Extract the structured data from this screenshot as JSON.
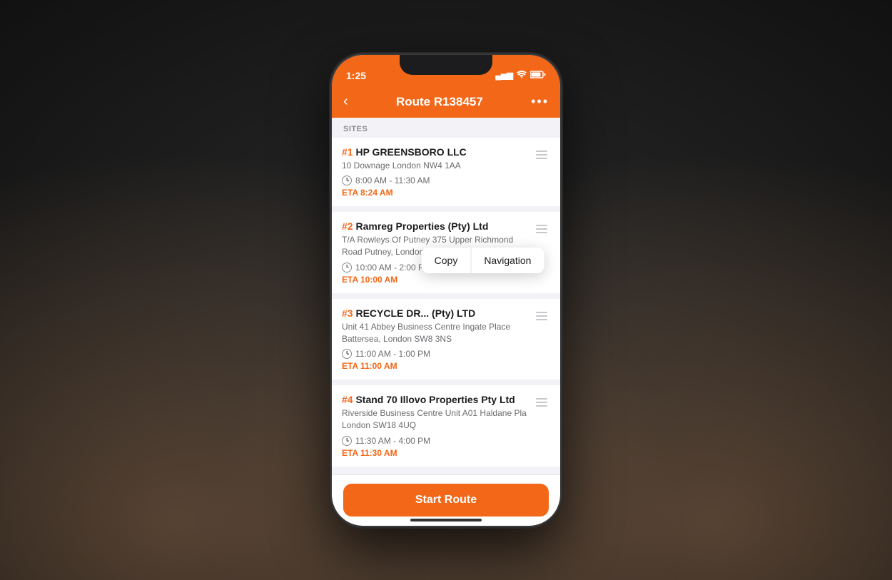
{
  "phone": {
    "status_bar": {
      "time": "1:25",
      "signal": "▄▅▆",
      "wifi": "WiFi",
      "battery": "Battery"
    },
    "nav": {
      "title": "Route R138457",
      "back_label": "‹",
      "more_label": "•••"
    },
    "section_label": "SITES",
    "sites": [
      {
        "number": "#1",
        "name": "HP GREENSBORO LLC",
        "address": "10 Downage London NW4 1AA",
        "hours": "8:00 AM - 11:30 AM",
        "eta_label": "ETA 8:24 AM"
      },
      {
        "number": "#2",
        "name": "Ramreg Properties (Pty) Ltd",
        "address": "T/A Rowleys Of Putney 375 Upper Richmond Road Putney, London SW15 5QJ",
        "hours": "10:00 AM - 2:00 PM",
        "eta_label": "ETA 10:00 AM"
      },
      {
        "number": "#3",
        "name": "RECYCLE DR... (Pty) LTD",
        "address": "Unit 41 Abbey Business Centre Ingate Place Battersea, London SW8 3NS",
        "hours": "11:00 AM - 1:00 PM",
        "eta_label": "ETA 11:00 AM"
      },
      {
        "number": "#4",
        "name": "Stand 70 Illovo Properties Pty Ltd",
        "address": "Riverside Business Centre Unit A01 Haldane Pla London SW18 4UQ",
        "hours": "11:30 AM - 4:00 PM",
        "eta_label": "ETA 11:30 AM"
      }
    ],
    "context_menu": {
      "copy_label": "Copy",
      "navigation_label": "Navigation"
    },
    "start_route_button": "Start Route"
  }
}
